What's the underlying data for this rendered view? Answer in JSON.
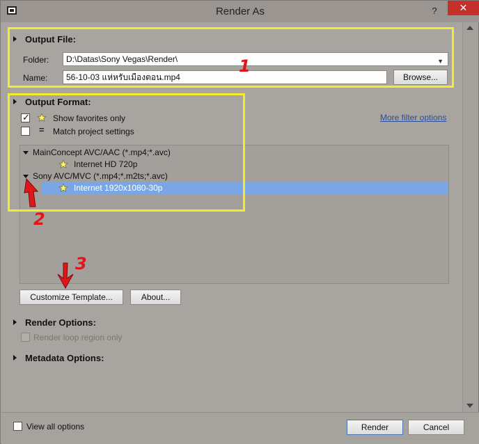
{
  "window": {
    "title": "Render As"
  },
  "titlebar": {
    "help": "?",
    "close": "✕"
  },
  "output_file": {
    "header": "Output File:",
    "folder_label": "Folder:",
    "folder_value": "D:\\Datas\\Sony Vegas\\Render\\",
    "name_label": "Name:",
    "name_value": "56-10-03 แห่หรับเมืองตอน.mp4",
    "browse_label": "Browse..."
  },
  "output_format": {
    "header": "Output Format:",
    "show_favorites_label": "Show favorites only",
    "show_favorites_checked": true,
    "match_project_label": "Match project settings",
    "match_project_checked": false,
    "more_filter_link": "More filter options",
    "tree": [
      {
        "label": "MainConcept AVC/AAC (*.mp4;*.avc)",
        "type": "group",
        "expanded": true
      },
      {
        "label": "Internet HD 720p",
        "type": "template",
        "favorite": true,
        "selected": false
      },
      {
        "label": "Sony AVC/MVC (*.mp4;*.m2ts;*.avc)",
        "type": "group",
        "expanded": true
      },
      {
        "label": "Internet 1920x1080-30p",
        "type": "template",
        "favorite": true,
        "selected": true
      }
    ],
    "customize_label": "Customize Template...",
    "about_label": "About..."
  },
  "render_options": {
    "header": "Render Options:",
    "loop_region_label": "Render loop region only",
    "loop_region_enabled": false
  },
  "metadata_options": {
    "header": "Metadata Options:"
  },
  "bottom": {
    "view_all_label": "View all options",
    "render_label": "Render",
    "cancel_label": "Cancel"
  },
  "annotations": {
    "one": "1",
    "two": "2",
    "three": "3"
  },
  "colors": {
    "highlight": "#f2ec2a",
    "annotation": "#e0161a",
    "selection": "#7aa6e6",
    "link": "#2a4d9c"
  }
}
